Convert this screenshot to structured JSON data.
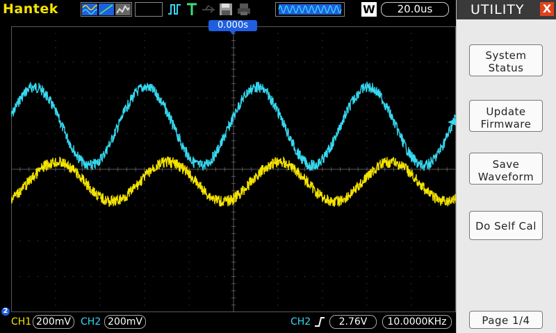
{
  "topbar": {
    "brand": "Hantek",
    "timebase": "20.0us",
    "w_label": "W",
    "icons": [
      "ch-wave-icon",
      "ch-ramp-icon",
      "ch-dither-icon",
      "run-stop-icon",
      "trigger-t-icon",
      "usb-icon",
      "floppy-save-icon",
      "printer-icon",
      "memory-wave-icon"
    ]
  },
  "screen": {
    "trigger_position": "0.000s",
    "grid": true,
    "colors": {
      "ch1": "#f5e400",
      "ch2": "#35d9f0",
      "grid": "#5a5a5a",
      "marker": "#1f5ee0"
    }
  },
  "chart_data": {
    "type": "line",
    "series": [
      {
        "name": "CH2",
        "color": "#35d9f0",
        "amplitude_div": 1.1,
        "offset_div": 1.2,
        "period_div": 2.5,
        "phase_div": -0.1
      },
      {
        "name": "CH1",
        "color": "#f5e400",
        "amplitude_div": 0.55,
        "offset_div": -0.35,
        "period_div": 2.5,
        "phase_div": 0.4
      }
    ],
    "divisions": {
      "x": 10,
      "y": 8
    }
  },
  "bottombar": {
    "ch2_marker": "2",
    "ch1_label": "CH1",
    "ch1_volt": "200mV",
    "ch2_label": "CH2",
    "ch2_volt": "200mV",
    "trigger_source": "CH2",
    "trigger_level": "2.76V",
    "trigger_freq": "10.0000KHz"
  },
  "menu": {
    "title": "UTILITY",
    "close": "X",
    "system_status_line1": "System",
    "system_status_line2": "Status",
    "update_firmware_line1": "Update",
    "update_firmware_line2": "Firmware",
    "save_waveform_line1": "Save",
    "save_waveform_line2": "Waveform",
    "self_cal": "Do Self Cal",
    "page": "Page 1/4"
  }
}
